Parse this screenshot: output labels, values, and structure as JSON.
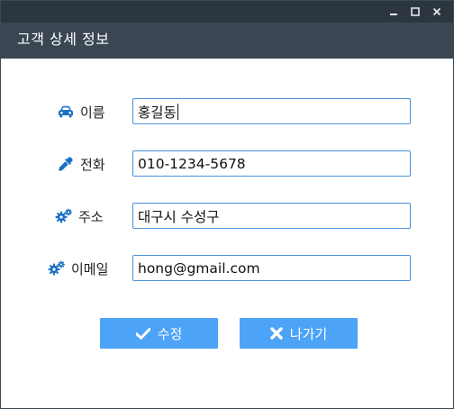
{
  "window": {
    "title": "고객 상세 정보",
    "controls": [
      "minimize-icon",
      "maximize-icon",
      "close-icon"
    ]
  },
  "form": {
    "name": {
      "label": "이름",
      "icon": "car-icon",
      "value": "홍길동"
    },
    "phone": {
      "label": "전화",
      "icon": "eyedropper-icon",
      "value": "010-1234-5678"
    },
    "address": {
      "label": "주소",
      "icon": "gears-icon",
      "value": "대구시 수성구"
    },
    "email": {
      "label": "이메일",
      "icon": "gears-icon",
      "value": "hong@gmail.com"
    }
  },
  "buttons": {
    "save": {
      "label": "수정",
      "icon": "check-icon"
    },
    "exit": {
      "label": "나가기",
      "icon": "x-icon"
    }
  },
  "colors": {
    "titlebar": "#2b3640",
    "header": "#3a4752",
    "accent": "#4da3f7",
    "icon": "#1a6fc4",
    "input_border": "#4a90d9"
  }
}
